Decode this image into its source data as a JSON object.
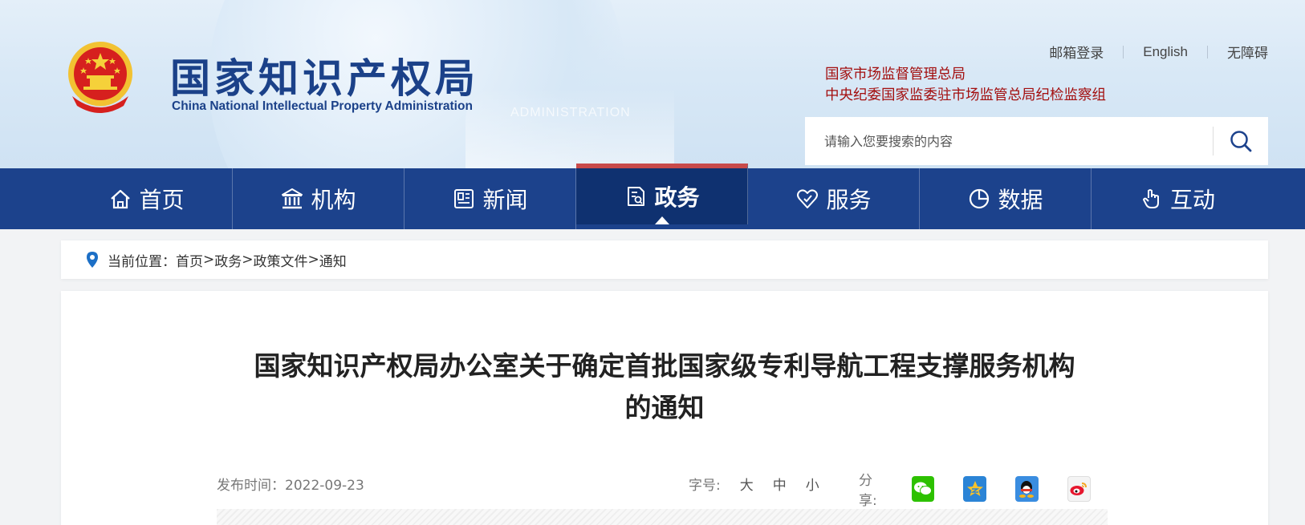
{
  "header": {
    "logo_cn": "国家知识产权局",
    "logo_en": "China National Intellectual Property Administration",
    "watermark": "ADMINISTRATION",
    "top_links": [
      "邮箱登录",
      "English",
      "无障碍"
    ],
    "org_links": [
      "国家市场监督管理总局",
      "中央纪委国家监委驻市场监管总局纪检监察组"
    ],
    "search_placeholder": "请输入您要搜索的内容"
  },
  "nav": {
    "items": [
      {
        "label": "首页",
        "icon": "home-icon"
      },
      {
        "label": "机构",
        "icon": "institution-icon"
      },
      {
        "label": "新闻",
        "icon": "news-icon"
      },
      {
        "label": "政务",
        "icon": "government-affairs-icon",
        "active": true
      },
      {
        "label": "服务",
        "icon": "service-icon"
      },
      {
        "label": "数据",
        "icon": "data-chart-icon"
      },
      {
        "label": "互动",
        "icon": "interact-hand-icon"
      }
    ]
  },
  "breadcrumb": {
    "prefix": "当前位置：",
    "items": [
      "首页",
      "政务",
      "政策文件",
      "通知"
    ],
    "separator": ">"
  },
  "article": {
    "title_line1": "国家知识产权局办公室关于确定首批国家级专利导航工程支撑服务机构",
    "title_line2": "的通知",
    "publish_label": "发布时间：",
    "publish_date": "2022-09-23",
    "font_label": "字号:",
    "font_sizes": [
      "大",
      "中",
      "小"
    ],
    "share_label": "分享:",
    "share_icons": [
      "wechat-icon",
      "qzone-icon",
      "qq-icon",
      "weibo-icon"
    ]
  },
  "colors": {
    "nav_bg": "#1c428c",
    "nav_active_bg": "#0f3170",
    "nav_active_top": "#c84a4a",
    "logo_blue": "#1b4189",
    "org_link_red": "#a30e0e"
  }
}
